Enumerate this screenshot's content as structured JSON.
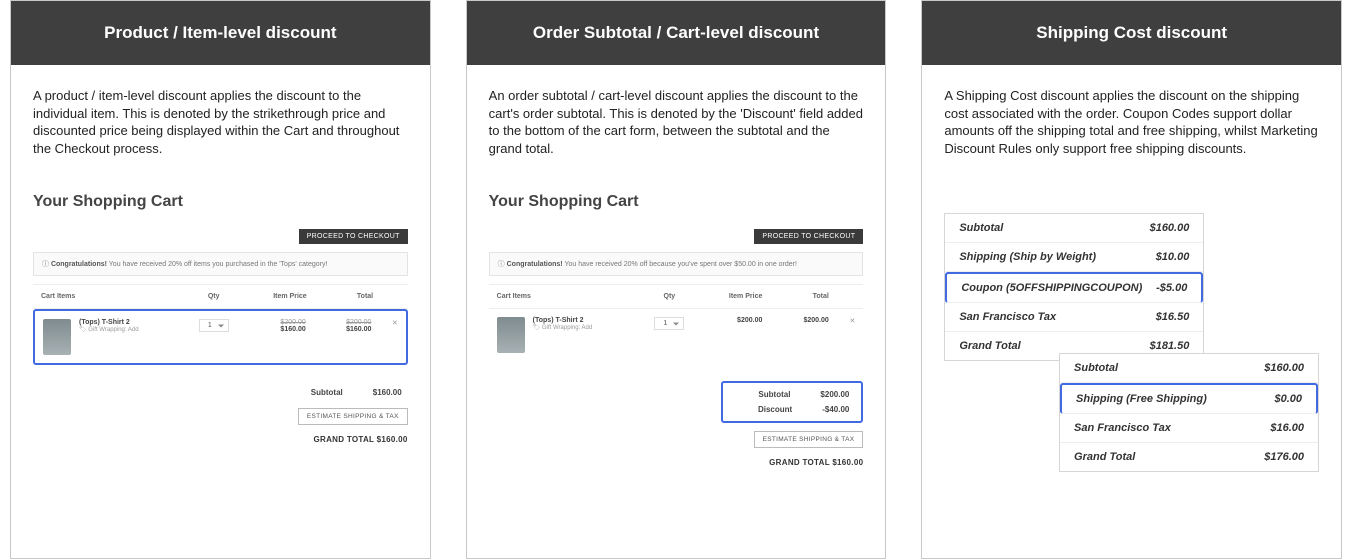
{
  "card1": {
    "title": "Product / Item-level discount",
    "desc": "A product / item-level discount applies the discount to the individual item. This is denoted by the strikethrough price and discounted price being displayed within the Cart and throughout the Checkout process.",
    "cart_title": "Your Shopping Cart",
    "checkout_btn": "PROCEED TO CHECKOUT",
    "congrats_label": "Congratulations!",
    "congrats_text": "You have received 20% off items you purchased in the 'Tops' category!",
    "cols": {
      "items": "Cart Items",
      "qty": "Qty",
      "price": "Item Price",
      "total": "Total"
    },
    "item": {
      "name": "(Tops) T-Shirt 2",
      "tag_icon": "🏷",
      "tag": "Gift Wrapping: Add",
      "qty": "1",
      "price_strike": "$200.00",
      "price": "$160.00",
      "total_strike": "$200.00",
      "total": "$160.00"
    },
    "subtotal_label": "Subtotal",
    "subtotal": "$160.00",
    "estimate_btn": "ESTIMATE SHIPPING & TAX",
    "grand_label": "GRAND TOTAL",
    "grand": "$160.00"
  },
  "card2": {
    "title": "Order Subtotal / Cart-level discount",
    "desc": "An order subtotal / cart-level discount applies the discount to the cart's order subtotal. This is denoted by the 'Discount' field added to the bottom of the cart form, between the subtotal and the grand total.",
    "cart_title": "Your Shopping Cart",
    "checkout_btn": "PROCEED TO CHECKOUT",
    "congrats_label": "Congratulations!",
    "congrats_text": "You have received 20% off because you've spent over $50.00 in one order!",
    "cols": {
      "items": "Cart Items",
      "qty": "Qty",
      "price": "Item Price",
      "total": "Total"
    },
    "item": {
      "name": "(Tops) T-Shirt 2",
      "tag_icon": "🏷",
      "tag": "Gift Wrapping: Add",
      "qty": "1",
      "price": "$200.00",
      "total": "$200.00"
    },
    "subtotal_label": "Subtotal",
    "subtotal": "$200.00",
    "discount_label": "Discount",
    "discount": "-$40.00",
    "estimate_btn": "ESTIMATE SHIPPING & TAX",
    "grand_label": "GRAND TOTAL",
    "grand": "$160.00"
  },
  "card3": {
    "title": "Shipping Cost discount",
    "desc": "A Shipping Cost discount applies the discount on the shipping cost associated with the order. Coupon Codes support dollar amounts off the shipping total and free shipping, whilst Marketing Discount Rules only support free shipping discounts.",
    "summary_top": {
      "rows": [
        {
          "lbl": "Subtotal",
          "val": "$160.00"
        },
        {
          "lbl": "Shipping (Ship by Weight)",
          "val": "$10.00"
        },
        {
          "lbl": "Coupon (5OFFSHIPPINGCOUPON)",
          "val": "-$5.00",
          "highlight": true
        },
        {
          "lbl": "San Francisco Tax",
          "val": "$16.50"
        },
        {
          "lbl": "Grand Total",
          "val": "$181.50"
        }
      ]
    },
    "summary_bot": {
      "rows": [
        {
          "lbl": "Subtotal",
          "val": "$160.00"
        },
        {
          "lbl": "Shipping (Free Shipping)",
          "val": "$0.00",
          "highlight": true
        },
        {
          "lbl": "San Francisco Tax",
          "val": "$16.00"
        },
        {
          "lbl": "Grand Total",
          "val": "$176.00"
        }
      ]
    }
  }
}
